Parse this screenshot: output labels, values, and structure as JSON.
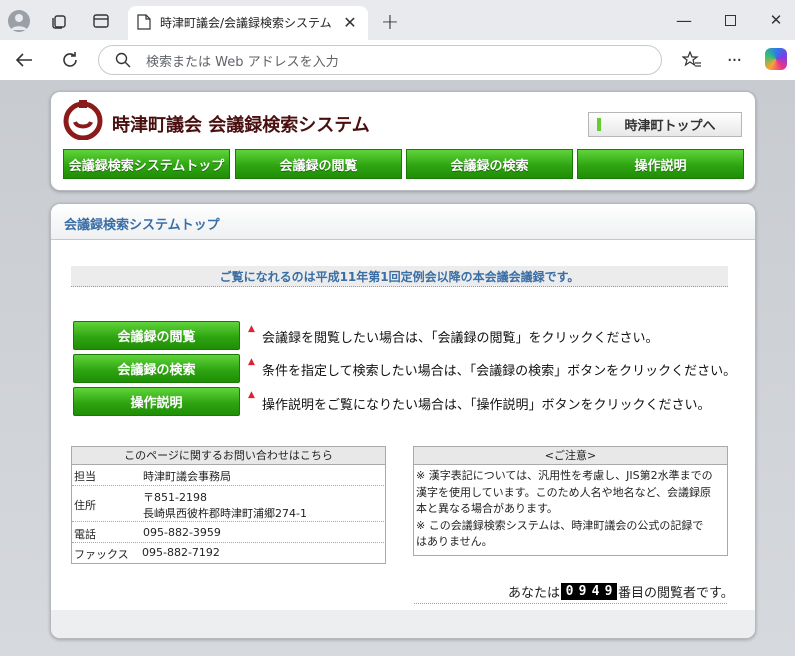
{
  "browser": {
    "tab_title": "時津町議会/会議録検索システム",
    "address_placeholder": "検索または Web アドレスを入力"
  },
  "site": {
    "title": "時津町議会 会議録検索システム",
    "top_link": "時津町トップへ",
    "nav": [
      "会議録検索システムトップ",
      "会議録の閲覧",
      "会議録の検索",
      "操作説明"
    ]
  },
  "main": {
    "heading": "会議録検索システムトップ",
    "notice": "ご覧になれるのは平成11年第1回定例会以降の本会議会議録です。",
    "actions": [
      {
        "label": "会議録の閲覧",
        "desc": "会議録を閲覧したい場合は、「会議録の閲覧」をクリックください。"
      },
      {
        "label": "会議録の検索",
        "desc": "条件を指定して検索したい場合は、「会議録の検索」ボタンをクリックください。"
      },
      {
        "label": "操作説明",
        "desc": "操作説明をご覧になりたい場合は、「操作説明」ボタンをクリックください。"
      }
    ],
    "contact": {
      "header": "このページに関するお問い合わせはこちら",
      "rows": [
        {
          "k": "担当",
          "v": "時津町議会事務局"
        },
        {
          "k": "住所",
          "v": "〒851-2198",
          "v2": "長崎県西彼杵郡時津町浦郷274-1"
        },
        {
          "k": "電話",
          "v": "095-882-3959"
        },
        {
          "k": "ファックス",
          "v": "095-882-7192"
        }
      ]
    },
    "caution": {
      "header": "<ご注意>",
      "lines": [
        "※ 漢字表記については、汎用性を考慮し、JIS第2水準までの",
        "漢字を使用しています。このため人名や地名など、会議録原",
        "本と異なる場合があります。",
        "※ この会議録検索システムは、時津町議会の公式の記録で",
        "はありません。"
      ]
    },
    "counter": {
      "prefix": "あなたは",
      "digits": [
        "0",
        "9",
        "4",
        "9"
      ],
      "suffix": "番目の閲覧者です。"
    }
  }
}
